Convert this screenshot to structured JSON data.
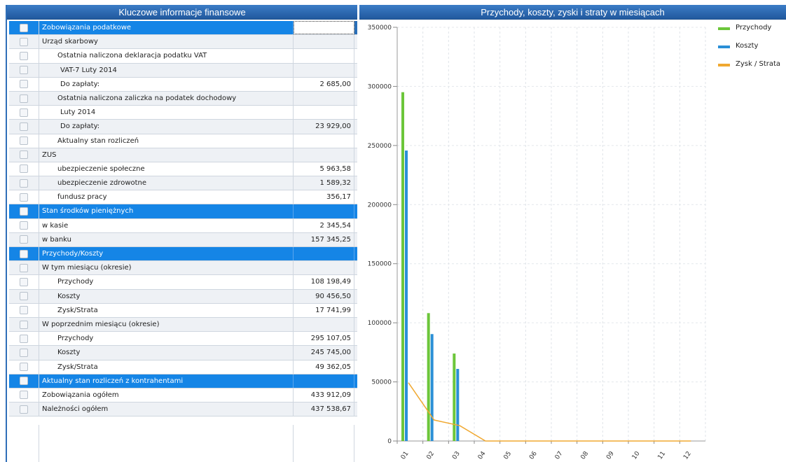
{
  "left_panel": {
    "title": "Kluczowe informacje finansowe",
    "rows": [
      {
        "label": "Zobowiązania podatkowe",
        "value": "",
        "type": "head",
        "indent": 0
      },
      {
        "label": "Urząd skarbowy",
        "value": "",
        "type": "gray",
        "indent": 0
      },
      {
        "label": "Ostatnia naliczona deklaracja podatku VAT",
        "value": "",
        "type": "white",
        "indent": 1
      },
      {
        "label": "VAT-7 Luty 2014",
        "value": "",
        "type": "gray",
        "indent": 2
      },
      {
        "label": "Do zapłaty:",
        "value": "2 685,00",
        "type": "white",
        "indent": 2
      },
      {
        "label": "Ostatnia naliczona zaliczka na podatek dochodowy",
        "value": "",
        "type": "gray",
        "indent": 1
      },
      {
        "label": "Luty 2014",
        "value": "",
        "type": "white",
        "indent": 2
      },
      {
        "label": "Do zapłaty:",
        "value": "23 929,00",
        "type": "gray",
        "indent": 2
      },
      {
        "label": "Aktualny stan rozliczeń",
        "value": "",
        "type": "white",
        "indent": 1
      },
      {
        "label": "ZUS",
        "value": "",
        "type": "gray",
        "indent": 0
      },
      {
        "label": "ubezpieczenie społeczne",
        "value": "5 963,58",
        "type": "white",
        "indent": 1
      },
      {
        "label": "ubezpieczenie zdrowotne",
        "value": "1 589,32",
        "type": "gray",
        "indent": 1
      },
      {
        "label": "fundusz pracy",
        "value": "356,17",
        "type": "white",
        "indent": 1
      },
      {
        "label": "Stan środków pieniężnych",
        "value": "",
        "type": "head",
        "indent": 0
      },
      {
        "label": "w kasie",
        "value": "2 345,54",
        "type": "white",
        "indent": 0
      },
      {
        "label": "w banku",
        "value": "157 345,25",
        "type": "gray",
        "indent": 0
      },
      {
        "label": "Przychody/Koszty",
        "value": "",
        "type": "head",
        "indent": 0
      },
      {
        "label": "W tym miesiącu (okresie)",
        "value": "",
        "type": "gray",
        "indent": 0
      },
      {
        "label": "Przychody",
        "value": "108 198,49",
        "type": "white",
        "indent": 1
      },
      {
        "label": "Koszty",
        "value": "90 456,50",
        "type": "gray",
        "indent": 1
      },
      {
        "label": "Zysk/Strata",
        "value": "17 741,99",
        "type": "white",
        "indent": 1
      },
      {
        "label": "W poprzednim miesiącu (okresie)",
        "value": "",
        "type": "gray",
        "indent": 0
      },
      {
        "label": "Przychody",
        "value": "295 107,05",
        "type": "white",
        "indent": 1
      },
      {
        "label": "Koszty",
        "value": "245 745,00",
        "type": "gray",
        "indent": 1
      },
      {
        "label": "Zysk/Strata",
        "value": "49 362,05",
        "type": "white",
        "indent": 1
      },
      {
        "label": "Aktualny stan rozliczeń z kontrahentami",
        "value": "",
        "type": "head",
        "indent": 0
      },
      {
        "label": "Zobowiązania ogółem",
        "value": "433 912,09",
        "type": "white",
        "indent": 0
      },
      {
        "label": "Należności ogółem",
        "value": "437 538,67",
        "type": "gray",
        "indent": 0
      }
    ]
  },
  "right_panel": {
    "title": "Przychody, koszty, zyski i straty w miesiącach"
  },
  "chart_data": {
    "type": "bar",
    "title": "Przychody, koszty, zyski i straty w miesiącach",
    "categories": [
      "01",
      "02",
      "03",
      "04",
      "05",
      "06",
      "07",
      "08",
      "09",
      "10",
      "11",
      "12"
    ],
    "series": [
      {
        "name": "Przychody",
        "kind": "bar",
        "color": "#6cc63a",
        "values": [
          295107.05,
          108198.49,
          74000,
          0,
          0,
          0,
          0,
          0,
          0,
          0,
          0,
          0
        ]
      },
      {
        "name": "Koszty",
        "kind": "bar",
        "color": "#2a8fd6",
        "values": [
          245745.0,
          90456.5,
          61000,
          0,
          0,
          0,
          0,
          0,
          0,
          0,
          0,
          0
        ]
      },
      {
        "name": "Zysk / Strata",
        "kind": "line",
        "color": "#f0a830",
        "values": [
          49362.05,
          17741.99,
          13000,
          0,
          0,
          0,
          0,
          0,
          0,
          0,
          0,
          0
        ]
      }
    ],
    "y_ticks": [
      "0",
      "50000",
      "100000",
      "150000",
      "200000",
      "250000",
      "300000",
      "350000"
    ],
    "ylim": [
      0,
      350000
    ],
    "legend_position": "top-right",
    "grid": true
  }
}
